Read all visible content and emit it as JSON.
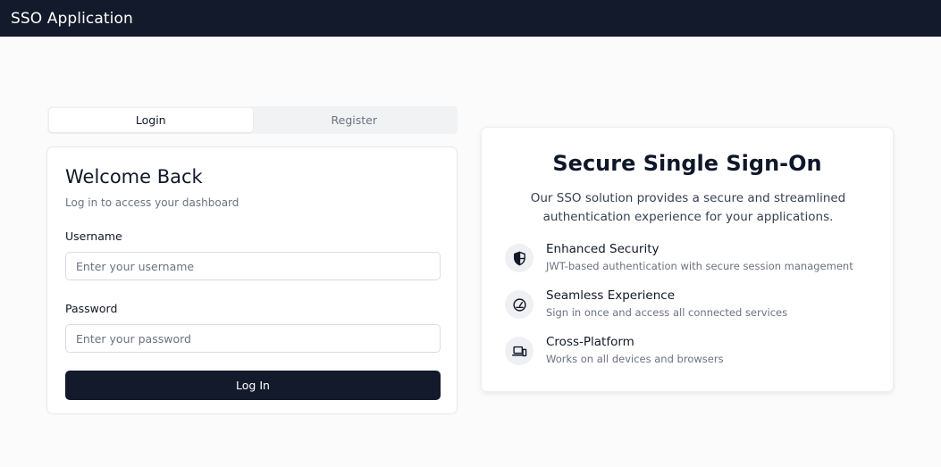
{
  "app": {
    "title": "SSO Application"
  },
  "tabs": [
    {
      "label": "Login",
      "active": true
    },
    {
      "label": "Register",
      "active": false
    }
  ],
  "login": {
    "title": "Welcome Back",
    "subtitle": "Log in to access your dashboard",
    "username": {
      "label": "Username",
      "placeholder": "Enter your username",
      "value": ""
    },
    "password": {
      "label": "Password",
      "placeholder": "Enter your password",
      "value": ""
    },
    "submit_label": "Log In"
  },
  "info": {
    "title": "Secure Single Sign-On",
    "description": "Our SSO solution provides a secure and streamlined authentication experience for your applications.",
    "features": [
      {
        "icon": "shield-icon",
        "title": "Enhanced Security",
        "description": "JWT-based authentication with secure session management"
      },
      {
        "icon": "gauge-icon",
        "title": "Seamless Experience",
        "description": "Sign in once and access all connected services"
      },
      {
        "icon": "devices-icon",
        "title": "Cross-Platform",
        "description": "Works on all devices and browsers"
      }
    ]
  },
  "colors": {
    "header_bg": "#131a2b",
    "primary_button": "#131a2b",
    "page_bg": "#fbfbfc"
  }
}
